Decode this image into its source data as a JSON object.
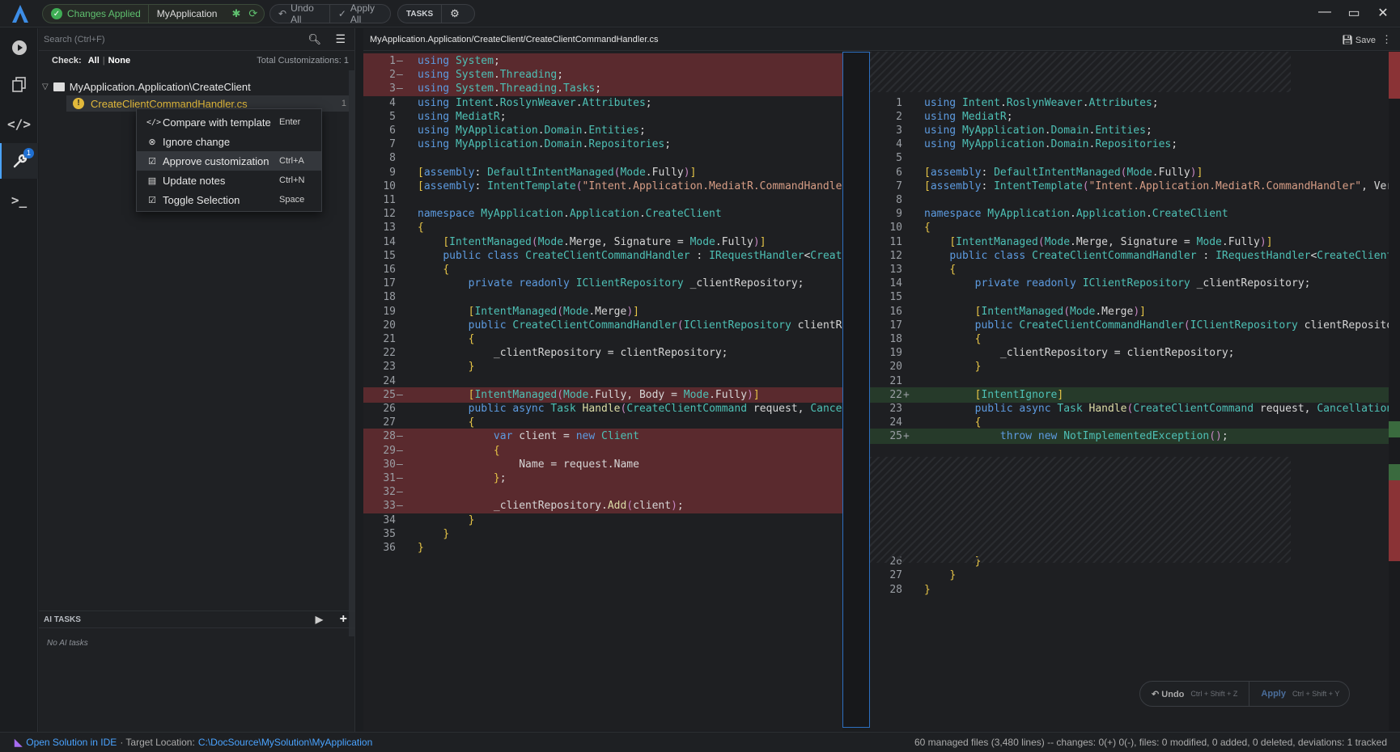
{
  "topbar": {
    "status": "Changes Applied",
    "app_name": "MyApplication",
    "undo_all": "Undo All",
    "apply_all": "Apply All",
    "tasks": "TASKS",
    "minimize": "—",
    "maximize": "▭",
    "close": "✕"
  },
  "sidebar": {
    "search_placeholder": "Search (Ctrl+F)",
    "check_label": "Check:",
    "check_all": "All",
    "check_none": "None",
    "total": "Total Customizations: 1",
    "folder": "MyApplication.Application\\CreateClient",
    "file": "CreateClientCommandHandler.cs",
    "file_count": "1",
    "ai_tasks_title": "AI TASKS",
    "ai_tasks_empty": "No AI tasks"
  },
  "context_menu": {
    "items": [
      {
        "label": "Compare with template",
        "shortcut": "Enter",
        "icon": "code-icon"
      },
      {
        "label": "Ignore change",
        "shortcut": "",
        "icon": "ignore-icon"
      },
      {
        "label": "Approve customization",
        "shortcut": "Ctrl+A",
        "icon": "checkbox-icon"
      },
      {
        "label": "Update notes",
        "shortcut": "Ctrl+N",
        "icon": "note-icon"
      },
      {
        "label": "Toggle Selection",
        "shortcut": "Space",
        "icon": "checkbox-icon"
      }
    ]
  },
  "editor": {
    "path": "MyApplication.Application/CreateClient/CreateClientCommandHandler.cs",
    "save": "Save",
    "undo": "Undo",
    "undo_shortcut": "Ctrl + Shift + Z",
    "apply": "Apply",
    "apply_shortcut": "Ctrl + Shift + Y"
  },
  "left_code": [
    {
      "n": "1",
      "m": "—",
      "t": "using System;",
      "s": "del"
    },
    {
      "n": "2",
      "m": "—",
      "t": "using System.Threading;",
      "s": "del"
    },
    {
      "n": "3",
      "m": "—",
      "t": "using System.Threading.Tasks;",
      "s": "del"
    },
    {
      "n": "4",
      "m": "",
      "t": "using Intent.RoslynWeaver.Attributes;",
      "s": ""
    },
    {
      "n": "5",
      "m": "",
      "t": "using MediatR;",
      "s": ""
    },
    {
      "n": "6",
      "m": "",
      "t": "using MyApplication.Domain.Entities;",
      "s": ""
    },
    {
      "n": "7",
      "m": "",
      "t": "using MyApplication.Domain.Repositories;",
      "s": ""
    },
    {
      "n": "8",
      "m": "",
      "t": "",
      "s": ""
    },
    {
      "n": "9",
      "m": "",
      "t": "[assembly: DefaultIntentManaged(Mode.Fully)]",
      "s": ""
    },
    {
      "n": "10",
      "m": "",
      "t": "[assembly: IntentTemplate(\"Intent.Application.MediatR.CommandHandler",
      "s": ""
    },
    {
      "n": "11",
      "m": "",
      "t": "",
      "s": ""
    },
    {
      "n": "12",
      "m": "",
      "t": "namespace MyApplication.Application.CreateClient",
      "s": ""
    },
    {
      "n": "13",
      "m": "",
      "t": "{",
      "s": ""
    },
    {
      "n": "14",
      "m": "",
      "t": "    [IntentManaged(Mode.Merge, Signature = Mode.Fully)]",
      "s": ""
    },
    {
      "n": "15",
      "m": "",
      "t": "    public class CreateClientCommandHandler : IRequestHandler<Create",
      "s": ""
    },
    {
      "n": "16",
      "m": "",
      "t": "    {",
      "s": ""
    },
    {
      "n": "17",
      "m": "",
      "t": "        private readonly IClientRepository _clientRepository;",
      "s": ""
    },
    {
      "n": "18",
      "m": "",
      "t": "",
      "s": ""
    },
    {
      "n": "19",
      "m": "",
      "t": "        [IntentManaged(Mode.Merge)]",
      "s": ""
    },
    {
      "n": "20",
      "m": "",
      "t": "        public CreateClientCommandHandler(IClientRepository clientRe",
      "s": ""
    },
    {
      "n": "21",
      "m": "",
      "t": "        {",
      "s": ""
    },
    {
      "n": "22",
      "m": "",
      "t": "            _clientRepository = clientRepository;",
      "s": ""
    },
    {
      "n": "23",
      "m": "",
      "t": "        }",
      "s": ""
    },
    {
      "n": "24",
      "m": "",
      "t": "",
      "s": ""
    },
    {
      "n": "25",
      "m": "—",
      "t": "        [IntentManaged(Mode.Fully, Body = Mode.Fully)]",
      "s": "del"
    },
    {
      "n": "26",
      "m": "",
      "t": "        public async Task Handle(CreateClientCommand request, Cancel",
      "s": ""
    },
    {
      "n": "27",
      "m": "",
      "t": "        {",
      "s": ""
    },
    {
      "n": "28",
      "m": "—",
      "t": "            var client = new Client",
      "s": "del"
    },
    {
      "n": "29",
      "m": "—",
      "t": "            {",
      "s": "del"
    },
    {
      "n": "30",
      "m": "—",
      "t": "                Name = request.Name",
      "s": "del"
    },
    {
      "n": "31",
      "m": "—",
      "t": "            };",
      "s": "del"
    },
    {
      "n": "32",
      "m": "—",
      "t": "",
      "s": "del"
    },
    {
      "n": "33",
      "m": "—",
      "t": "            _clientRepository.Add(client);",
      "s": "del"
    },
    {
      "n": "34",
      "m": "",
      "t": "        }",
      "s": ""
    },
    {
      "n": "35",
      "m": "",
      "t": "    }",
      "s": ""
    },
    {
      "n": "36",
      "m": "",
      "t": "}",
      "s": ""
    }
  ],
  "right_code": [
    {
      "n": "1",
      "m": "",
      "t": "using Intent.RoslynWeaver.Attributes;",
      "s": ""
    },
    {
      "n": "2",
      "m": "",
      "t": "using MediatR;",
      "s": ""
    },
    {
      "n": "3",
      "m": "",
      "t": "using MyApplication.Domain.Entities;",
      "s": ""
    },
    {
      "n": "4",
      "m": "",
      "t": "using MyApplication.Domain.Repositories;",
      "s": ""
    },
    {
      "n": "5",
      "m": "",
      "t": "",
      "s": ""
    },
    {
      "n": "6",
      "m": "",
      "t": "[assembly: DefaultIntentManaged(Mode.Fully)]",
      "s": ""
    },
    {
      "n": "7",
      "m": "",
      "t": "[assembly: IntentTemplate(\"Intent.Application.MediatR.CommandHandler\", Vers",
      "s": ""
    },
    {
      "n": "8",
      "m": "",
      "t": "",
      "s": ""
    },
    {
      "n": "9",
      "m": "",
      "t": "namespace MyApplication.Application.CreateClient",
      "s": ""
    },
    {
      "n": "10",
      "m": "",
      "t": "{",
      "s": ""
    },
    {
      "n": "11",
      "m": "",
      "t": "    [IntentManaged(Mode.Merge, Signature = Mode.Fully)]",
      "s": ""
    },
    {
      "n": "12",
      "m": "",
      "t": "    public class CreateClientCommandHandler : IRequestHandler<CreateClientC",
      "s": ""
    },
    {
      "n": "13",
      "m": "",
      "t": "    {",
      "s": ""
    },
    {
      "n": "14",
      "m": "",
      "t": "        private readonly IClientRepository _clientRepository;",
      "s": ""
    },
    {
      "n": "15",
      "m": "",
      "t": "",
      "s": ""
    },
    {
      "n": "16",
      "m": "",
      "t": "        [IntentManaged(Mode.Merge)]",
      "s": ""
    },
    {
      "n": "17",
      "m": "",
      "t": "        public CreateClientCommandHandler(IClientRepository clientRepositor",
      "s": ""
    },
    {
      "n": "18",
      "m": "",
      "t": "        {",
      "s": ""
    },
    {
      "n": "19",
      "m": "",
      "t": "            _clientRepository = clientRepository;",
      "s": ""
    },
    {
      "n": "20",
      "m": "",
      "t": "        }",
      "s": ""
    },
    {
      "n": "21",
      "m": "",
      "t": "",
      "s": ""
    },
    {
      "n": "22",
      "m": "+",
      "t": "        [IntentIgnore]",
      "s": "add"
    },
    {
      "n": "23",
      "m": "",
      "t": "        public async Task Handle(CreateClientCommand request, CancellationT",
      "s": ""
    },
    {
      "n": "24",
      "m": "",
      "t": "        {",
      "s": ""
    },
    {
      "n": "25",
      "m": "+",
      "t": "            throw new NotImplementedException();",
      "s": "add"
    },
    {
      "n": "26",
      "m": "",
      "t": "        }",
      "s": ""
    },
    {
      "n": "27",
      "m": "",
      "t": "    }",
      "s": ""
    },
    {
      "n": "28",
      "m": "",
      "t": "}",
      "s": ""
    }
  ],
  "statusbar": {
    "open_ide": "Open Solution in IDE",
    "target_label": "· Target Location:",
    "target_path": "C:\\DocSource\\MySolution\\MyApplication",
    "summary": "60 managed files (3,480 lines) -- changes: 0(+) 0(-), files: 0 modified, 0 added, 0 deleted, deviations: 1 tracked"
  },
  "colors": {
    "accent": "#4aa3ff",
    "success": "#3fae55",
    "warning": "#e2b93b",
    "deleted_bg": "#5a2a2e",
    "added_bg": "#263a2a"
  }
}
